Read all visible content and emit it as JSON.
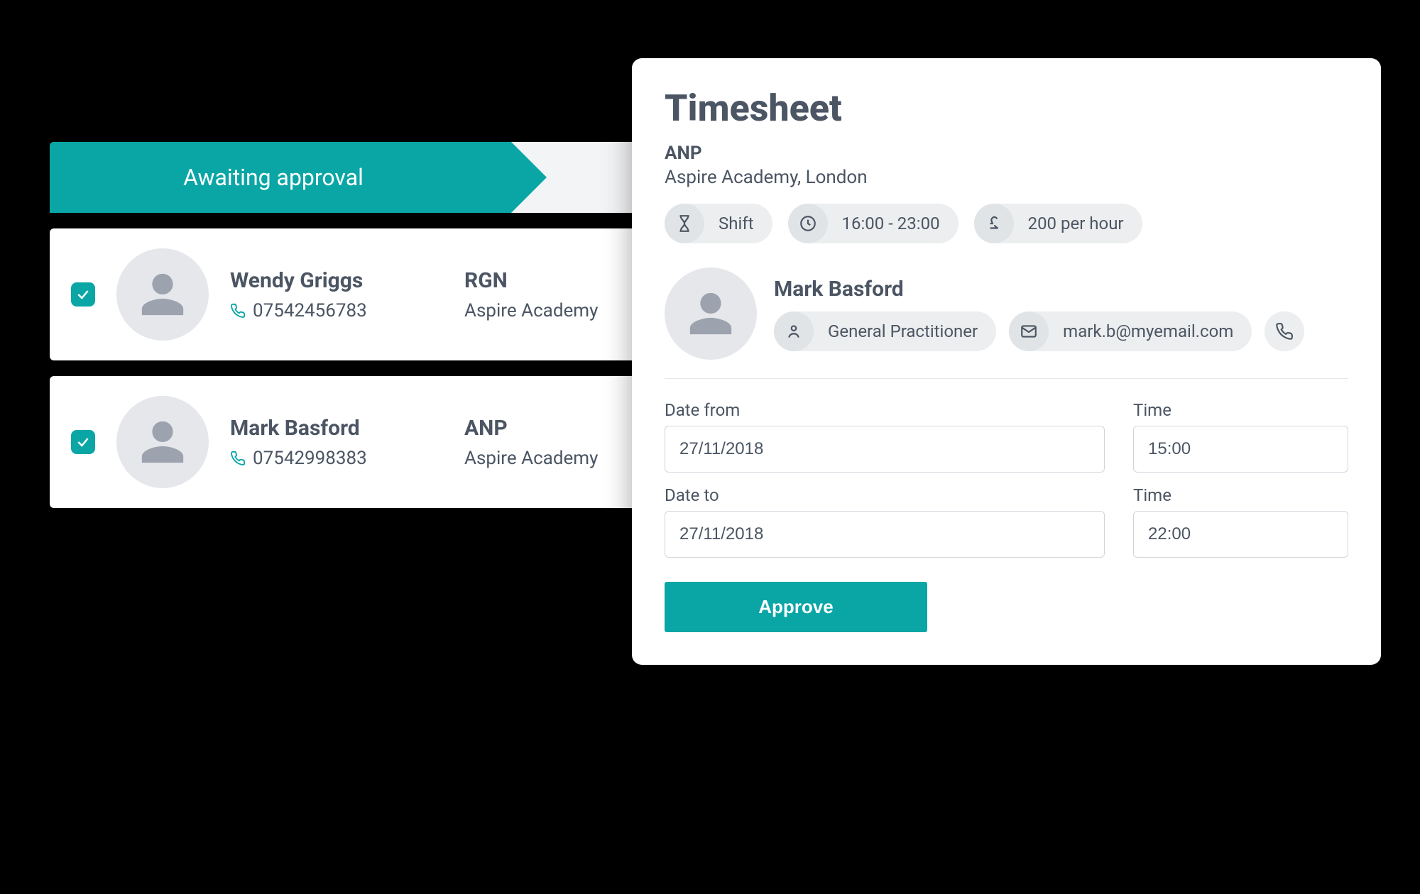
{
  "list": {
    "status_label": "Awaiting approval",
    "rows": [
      {
        "name": "Wendy Griggs",
        "phone": "07542456783",
        "role": "RGN",
        "location": "Aspire Academy",
        "checked": true
      },
      {
        "name": "Mark Basford",
        "phone": "07542998383",
        "role": "ANP",
        "location": "Aspire Academy",
        "checked": true
      }
    ]
  },
  "detail": {
    "title": "Timesheet",
    "job": {
      "title": "ANP",
      "location": "Aspire Academy, London"
    },
    "pills": {
      "shift_label": "Shift",
      "time_range": "16:00 - 23:00",
      "rate": "200 per hour"
    },
    "worker": {
      "name": "Mark Basford",
      "role": "General Practitioner",
      "email": "mark.b@myemail.com"
    },
    "form": {
      "date_from_label": "Date from",
      "date_from": "27/11/2018",
      "time_from_label": "Time",
      "time_from": "15:00",
      "date_to_label": "Date to",
      "date_to": "27/11/2018",
      "time_to_label": "Time",
      "time_to": "22:00"
    },
    "approve_label": "Approve"
  }
}
